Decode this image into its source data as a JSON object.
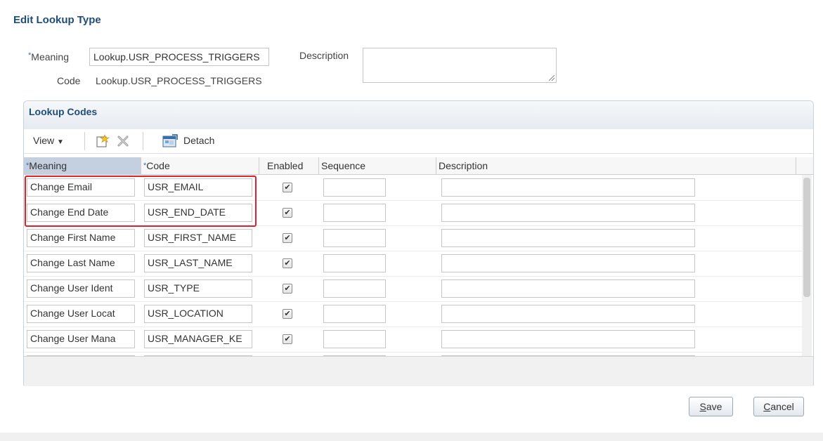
{
  "page": {
    "title": "Edit Lookup Type"
  },
  "form": {
    "meaning_label": "Meaning",
    "meaning_value": "Lookup.USR_PROCESS_TRIGGERS",
    "code_label": "Code",
    "code_value": "Lookup.USR_PROCESS_TRIGGERS",
    "description_label": "Description",
    "description_value": ""
  },
  "lookup_codes": {
    "title": "Lookup Codes",
    "toolbar": {
      "view_label": "View",
      "detach_label": "Detach"
    },
    "columns": [
      "Meaning",
      "Code",
      "Enabled",
      "Sequence",
      "Description"
    ],
    "rows": [
      {
        "meaning": "Change Email",
        "code": "USR_EMAIL",
        "enabled": true,
        "sequence": "",
        "description": ""
      },
      {
        "meaning": "Change End Date",
        "code": "USR_END_DATE",
        "enabled": true,
        "sequence": "",
        "description": ""
      },
      {
        "meaning": "Change First Name",
        "code": "USR_FIRST_NAME",
        "enabled": true,
        "sequence": "",
        "description": ""
      },
      {
        "meaning": "Change Last Name",
        "code": "USR_LAST_NAME",
        "enabled": true,
        "sequence": "",
        "description": ""
      },
      {
        "meaning": "Change User Ident",
        "code": "USR_TYPE",
        "enabled": true,
        "sequence": "",
        "description": ""
      },
      {
        "meaning": "Change User Locat",
        "code": "USR_LOCATION",
        "enabled": true,
        "sequence": "",
        "description": ""
      },
      {
        "meaning": "Change User Mana",
        "code": "USR_MANAGER_KE",
        "enabled": true,
        "sequence": "",
        "description": ""
      }
    ]
  },
  "buttons": {
    "save": "Save",
    "save_mnemonic": "S",
    "save_rest": "ave",
    "cancel_mnemonic": "C",
    "cancel_rest": "ancel"
  },
  "colors": {
    "title": "#1f4d78",
    "highlight": "#e0202a",
    "selected_header": "#c4cfe0"
  }
}
